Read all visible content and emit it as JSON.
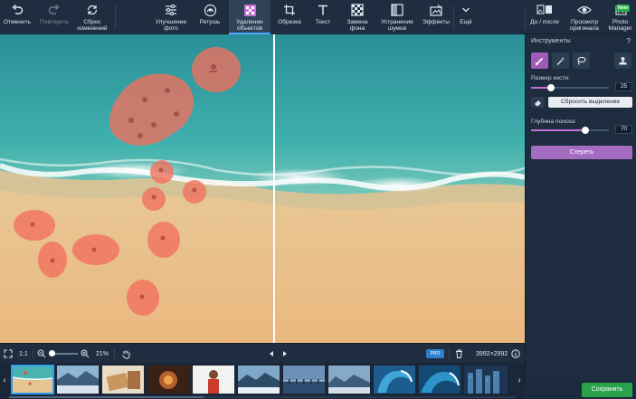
{
  "toolbar": {
    "undo": "Отменить",
    "redo": "Повторить",
    "reset": "Сброс\nизменений",
    "enhance": "Улучшение\nфото",
    "retouch": "Ретушь",
    "remove_objects": "Удаление\nобъектов",
    "crop": "Обрезка",
    "text": "Текст",
    "replace_bg": "Замена\nфона",
    "denoise": "Устранение\nшумов",
    "effects": "Эффекты",
    "more": "Ещё",
    "before_after": "До / после",
    "view_original": "Просмотр\nоригинала",
    "photo_manager": "Photo\nManager",
    "new_badge": "New"
  },
  "panel": {
    "tools_title": "Инструменты",
    "help": "?",
    "brush_size_label": "Размер кисти:",
    "brush_size": 25,
    "brush_size_max": 100,
    "reset_selection": "Сбросить выделение",
    "search_depth_label": "Глубина поиска:",
    "search_depth": 70,
    "search_depth_max": 100,
    "erase": "Стереть"
  },
  "bottombar": {
    "ratio": "1:1",
    "zoom": "21%",
    "resolution": "3992×2992",
    "badge": "PRO"
  },
  "save": "Сохранить",
  "colors": {
    "accent": "#a46cc0",
    "selection": "#4aa8ff",
    "save": "#2aa24b"
  }
}
